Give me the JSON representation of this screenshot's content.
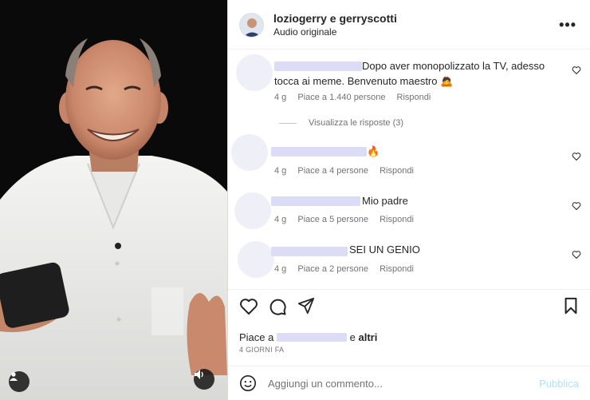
{
  "header": {
    "title": "loziogerry e gerryscotti",
    "subtitle": "Audio originale",
    "more_label": "•••"
  },
  "comments": [
    {
      "text": "Dopo aver monopolizzato la TV, adesso tocca ai meme. Benvenuto maestro 🙇",
      "age": "4 g",
      "likes": "Piace a 1.440 persone",
      "reply": "Rispondi"
    },
    {
      "text": "🔥",
      "age": "4 g",
      "likes": "Piace a 4 persone",
      "reply": "Rispondi"
    },
    {
      "text": "Mio padre",
      "age": "4 g",
      "likes": "Piace a 5 persone",
      "reply": "Rispondi"
    },
    {
      "text": "SEI UN GENIO",
      "age": "4 g",
      "likes": "Piace a 2 persone",
      "reply": "Rispondi"
    }
  ],
  "view_replies": "Visualizza le risposte (3)",
  "likes_line": {
    "prefix": "Piace a",
    "suffix": "e",
    "others": "altri"
  },
  "date": "4 GIORNI FA",
  "add_comment": {
    "placeholder": "Aggiungi un commento...",
    "publish": "Pubblica"
  },
  "icons": {
    "heart": "heart-icon",
    "comment": "comment-icon",
    "share": "paper-plane-icon",
    "save": "bookmark-icon",
    "emoji": "emoji-icon",
    "user": "user-icon",
    "audio": "speaker-icon"
  },
  "colors": {
    "publish_disabled": "#b2dffc",
    "muted_text": "#737373",
    "redaction": "#dcdcf7"
  }
}
